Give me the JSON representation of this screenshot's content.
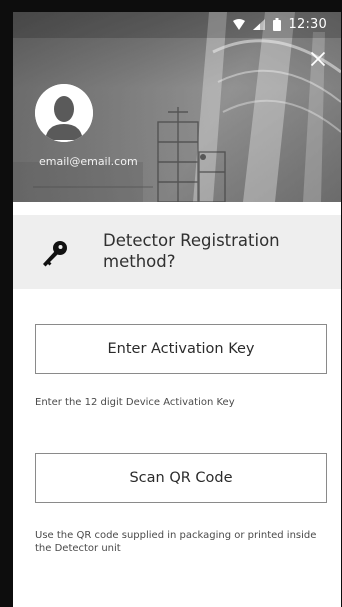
{
  "status_bar": {
    "time": "12:30",
    "icons": [
      "wifi-icon",
      "signal-icon",
      "battery-icon"
    ]
  },
  "header": {
    "close_icon": "close-icon",
    "avatar_icon": "user-avatar-icon",
    "email": "email@email.com"
  },
  "registration": {
    "icon": "key-icon",
    "title": "Detector Registration method?",
    "activation_button_label": "Enter Activation Key",
    "activation_hint": "Enter the 12 digit Device Activation Key",
    "qr_button_label": "Scan QR Code",
    "qr_hint": "Use the QR code supplied in packaging or printed inside the Detector unit"
  },
  "colors": {
    "frame": "#0d0d0d",
    "band": "#eeeeee",
    "button_border": "#8a8a8a",
    "text": "#2b2b2b"
  }
}
